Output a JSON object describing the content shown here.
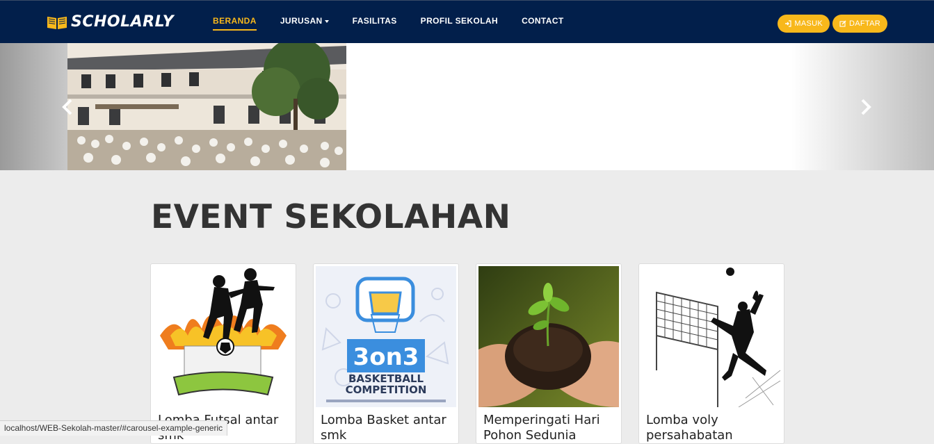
{
  "brand": {
    "name": "SCHOLARLY",
    "icon": "open-book-icon",
    "accent": "#f8b81b"
  },
  "nav": {
    "items": [
      {
        "label": "BERANDA",
        "active": true
      },
      {
        "label": "JURUSAN",
        "dropdown": true
      },
      {
        "label": "FASILITAS"
      },
      {
        "label": "PROFIL SEKOLAH"
      },
      {
        "label": "CONTACT"
      }
    ]
  },
  "auth": {
    "login": {
      "label": "MASUK",
      "icon": "sign-in-icon"
    },
    "register": {
      "label": "DAFTAR",
      "icon": "edit-icon"
    }
  },
  "carousel": {
    "prev_icon": "chevron-left-icon",
    "next_icon": "chevron-right-icon"
  },
  "events": {
    "title": "EVENT SEKOLAHAN",
    "cards": [
      {
        "title": "Lomba Futsal antar smk",
        "image": "futsal-tournament-logo"
      },
      {
        "title": "Lomba Basket antar smk",
        "image": "basketball-competition-poster"
      },
      {
        "title": "Memperingati Hari Pohon Sedunia",
        "image": "plant-in-hands-photo"
      },
      {
        "title": "Lomba voly persahabatan",
        "image": "volleyball-silhouette"
      }
    ]
  },
  "status_url": "localhost/WEB-Sekolah-master/#carousel-example-generic",
  "colors": {
    "navbar": "#021f4b",
    "accent": "#f8b81b",
    "background": "#ececec"
  }
}
